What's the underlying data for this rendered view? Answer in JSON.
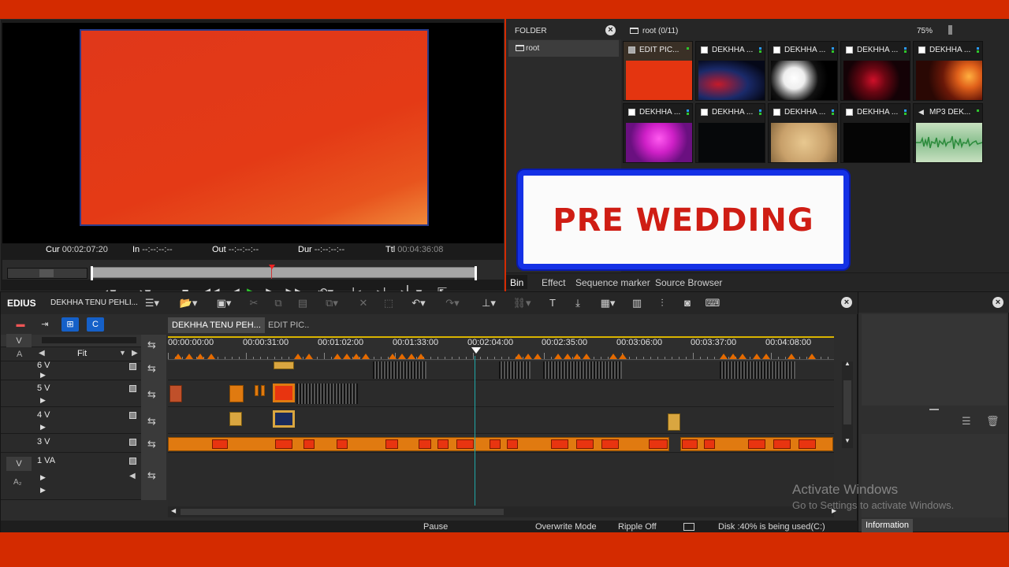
{
  "player": {
    "cur_label": "Cur",
    "cur_value": "00:02:07:20",
    "in_label": "In",
    "in_value": "--:--:--:--",
    "out_label": "Out",
    "out_value": "--:--:--:--",
    "dur_label": "Dur",
    "dur_value": "--:--:--:--",
    "ttl_label": "Ttl",
    "ttl_value": "00:04:36:08"
  },
  "bin": {
    "folder_title": "FOLDER",
    "tree_root": "root",
    "path_label": "root (0/11)",
    "zoom": "75%",
    "clips": [
      {
        "name": "EDIT PIC..."
      },
      {
        "name": "DEKHHA ..."
      },
      {
        "name": "DEKHHA ..."
      },
      {
        "name": "DEKHHA ..."
      },
      {
        "name": "DEKHHA ..."
      },
      {
        "name": "DEKHHA ..."
      },
      {
        "name": "DEKHHA ..."
      },
      {
        "name": "DEKHHA ..."
      },
      {
        "name": "DEKHHA ..."
      },
      {
        "name": "MP3 DEK..."
      }
    ],
    "tabs": [
      "Bin",
      "Effect",
      "Sequence marker",
      "Source Browser"
    ]
  },
  "overlay_card": {
    "text": "PRE WEDDING"
  },
  "timeline": {
    "logo": "EDIUS",
    "project": "DEKHHA TENU PEHLI...",
    "seq_tabs": [
      "DEKHHA TENU PEH...",
      "EDIT PIC.."
    ],
    "zoom_label": "Fit",
    "ruler": [
      "00:00:00:00",
      "00:00:31:00",
      "00:01:02:00",
      "00:01:33:00",
      "00:02:04:00",
      "00:02:35:00",
      "00:03:06:00",
      "00:03:37:00",
      "00:04:08:00"
    ],
    "tracks": [
      {
        "name": "6 V"
      },
      {
        "name": "5 V"
      },
      {
        "name": "4 V"
      },
      {
        "name": "3 V"
      },
      {
        "name": "1 VA"
      }
    ],
    "v_badge": "V",
    "a_badge": "A"
  },
  "status": {
    "state": "Pause",
    "mode": "Overwrite Mode",
    "ripple": "Ripple Off",
    "disk": "Disk :40% is being used(C:)"
  },
  "info_panel": {
    "tab": "Information"
  },
  "watermark": {
    "line1": "Activate Windows",
    "line2": "Go to Settings to activate Windows."
  }
}
